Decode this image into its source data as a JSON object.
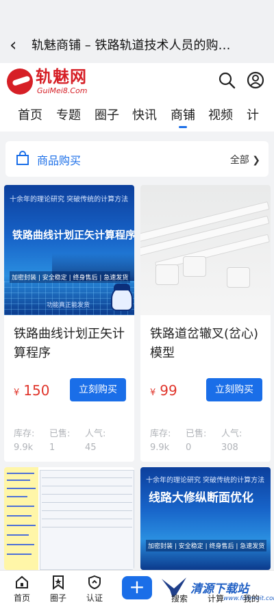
{
  "topbar": {
    "back_icon": "‹",
    "title": "轨魅商铺 – 铁路轨道技术人员的购…"
  },
  "header": {
    "logo_name": "轨魅网",
    "logo_domain": "GuiMei8.Com",
    "nav": [
      "首页",
      "专题",
      "圈子",
      "快讯",
      "商铺",
      "视频",
      "计"
    ],
    "active_nav": "商铺"
  },
  "section": {
    "label": "商品购买",
    "all": "全部 ❯"
  },
  "products": [
    {
      "thumb_tagline": "十余年的理论研究  突破传统的计算方法",
      "thumb_title": "铁路曲线计划正矢计算程序",
      "thumb_features": "加密封装 | 安全稳定 | 终身售后 | 急速发货",
      "thumb_footer": "功能真正能发货",
      "name": "铁路曲线计划正矢计算程序",
      "currency": "¥",
      "price": "150",
      "buy_label": "立刻购买",
      "stats": [
        {
          "label": "库存:",
          "value": "9.9k"
        },
        {
          "label": "已售:",
          "value": "1"
        },
        {
          "label": "人气:",
          "value": "45"
        }
      ]
    },
    {
      "name": "铁路道岔辙叉(岔心)模型",
      "currency": "¥",
      "price": "99",
      "buy_label": "立刻购买",
      "stats": [
        {
          "label": "库存:",
          "value": "9.9k"
        },
        {
          "label": "已售:",
          "value": "0"
        },
        {
          "label": "人气:",
          "value": "308"
        }
      ]
    },
    {
      "name": ""
    },
    {
      "thumb_tagline": "十余年的理论研究  突破传统的计算方法",
      "thumb_title": "线路大修纵断面优化",
      "thumb_features": "加密封装 | 安全稳定 | 终身售后 | 急速发货"
    }
  ],
  "tabbar": {
    "tabs": [
      "首页",
      "圈子",
      "认证",
      "搜索",
      "计算",
      "我的"
    ],
    "plus": "+",
    "watermark_text": "清源下载站",
    "watermark_url": "www.fofimeit.com"
  },
  "colors": {
    "accent": "#1a6ee8",
    "price": "#e0352b",
    "brand": "#d61f26"
  }
}
